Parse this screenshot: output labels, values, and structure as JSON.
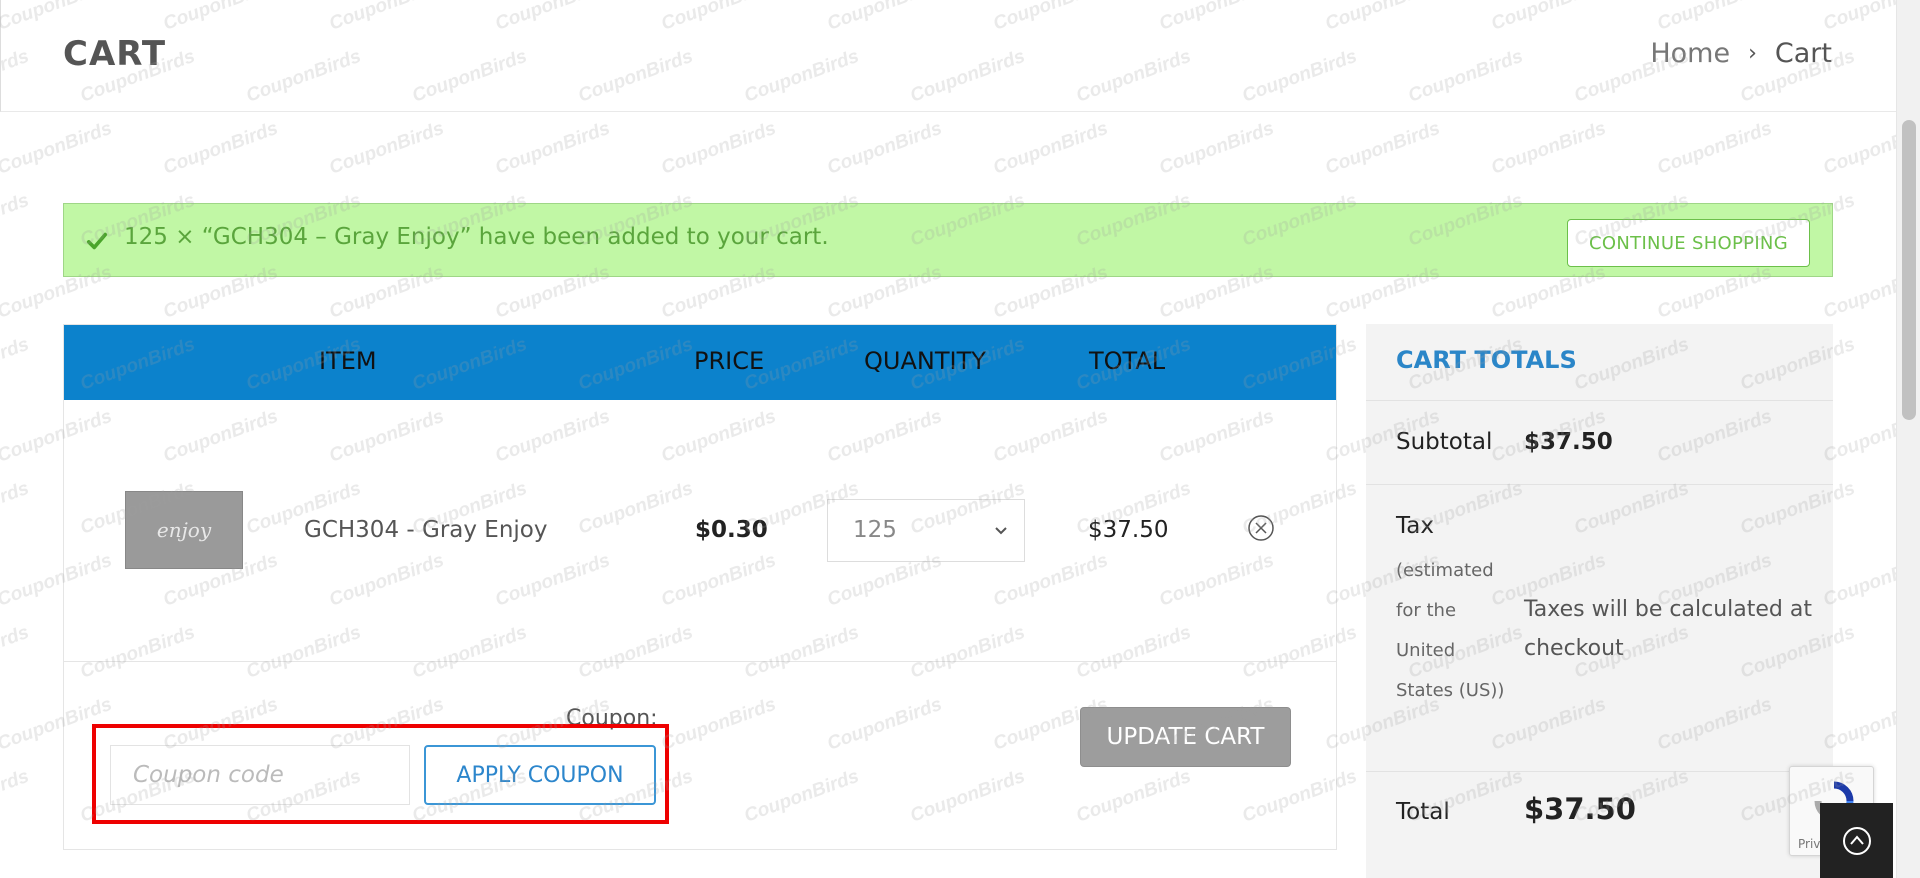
{
  "header": {
    "title": "CART",
    "breadcrumb": {
      "home": "Home",
      "separator": "›",
      "current": "Cart"
    }
  },
  "notice": {
    "icon": "check-icon",
    "message": "125 × “GCH304 – Gray Enjoy” have been added to your cart.",
    "continue_label": "CONTINUE SHOPPING",
    "colors": {
      "background": "#c1f7a5",
      "text": "#5aa53c"
    }
  },
  "table": {
    "headers": {
      "item": "ITEM",
      "price": "PRICE",
      "quantity": "QUANTITY",
      "total": "TOTAL"
    },
    "header_color": "#0c82cc",
    "rows": [
      {
        "thumbnail_text": "enjoy",
        "name": "GCH304 - Gray Enjoy",
        "price": "$0.30",
        "quantity": "125",
        "total": "$37.50",
        "remove_icon": "remove-circle-icon"
      }
    ]
  },
  "coupon": {
    "label": "Coupon:",
    "placeholder": "Coupon code",
    "value": "",
    "apply_label": "APPLY COUPON",
    "update_label": "UPDATE CART"
  },
  "totals": {
    "title": "CART TOTALS",
    "subtotal_label": "Subtotal",
    "subtotal_value": "$37.50",
    "tax_label": "Tax",
    "tax_note": "(estimated for the United States (US))",
    "tax_value": "Taxes will be calculated at checkout",
    "total_label": "Total",
    "total_value": "$37.50"
  },
  "recaptcha": {
    "text": "Priv"
  },
  "watermark": {
    "text": "CouponBirds"
  }
}
